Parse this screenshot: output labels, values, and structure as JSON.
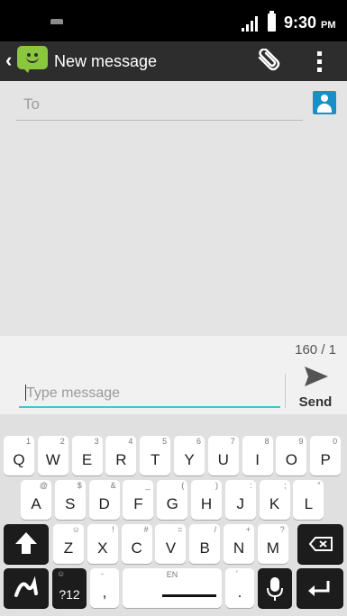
{
  "status_bar": {
    "time": "9:30",
    "ampm": "PM"
  },
  "action_bar": {
    "title": "New message"
  },
  "compose": {
    "to_placeholder": "To"
  },
  "message": {
    "counter": "160 / 1",
    "placeholder": "Type message",
    "send_label": "Send"
  },
  "keyboard": {
    "row1": [
      {
        "label": "Q",
        "hint": "1"
      },
      {
        "label": "W",
        "hint": "2"
      },
      {
        "label": "E",
        "hint": "3"
      },
      {
        "label": "R",
        "hint": "4"
      },
      {
        "label": "T",
        "hint": "5"
      },
      {
        "label": "Y",
        "hint": "6"
      },
      {
        "label": "U",
        "hint": "7"
      },
      {
        "label": "I",
        "hint": "8"
      },
      {
        "label": "O",
        "hint": "9"
      },
      {
        "label": "P",
        "hint": "0"
      }
    ],
    "row2": [
      {
        "label": "A",
        "hint": "@"
      },
      {
        "label": "S",
        "hint": "$"
      },
      {
        "label": "D",
        "hint": "&"
      },
      {
        "label": "F",
        "hint": "_"
      },
      {
        "label": "G",
        "hint": "("
      },
      {
        "label": "H",
        "hint": ")"
      },
      {
        "label": "J",
        "hint": ":"
      },
      {
        "label": "K",
        "hint": ";"
      },
      {
        "label": "L",
        "hint": "\""
      }
    ],
    "row3": [
      {
        "label": "Z",
        "hint": "☺"
      },
      {
        "label": "X",
        "hint": "!"
      },
      {
        "label": "C",
        "hint": "#"
      },
      {
        "label": "V",
        "hint": "="
      },
      {
        "label": "B",
        "hint": "/"
      },
      {
        "label": "N",
        "hint": "+"
      },
      {
        "label": "M",
        "hint": "?"
      }
    ],
    "symbols_label": "?12",
    "symbols_hint": "☺",
    "comma_label": ",",
    "comma_hint": "-",
    "space_lang": "EN",
    "period_label": ".",
    "period_hint": "'"
  }
}
